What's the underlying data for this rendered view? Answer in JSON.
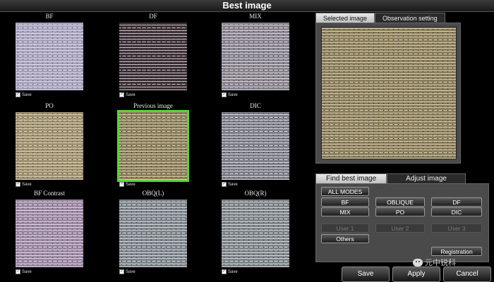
{
  "window": {
    "title": "Best image"
  },
  "tiles": [
    {
      "label": "BF",
      "save": "Save",
      "bg": "#a9a2bd",
      "line": "#e0dcef",
      "dot": "#555"
    },
    {
      "label": "DF",
      "save": "Save",
      "bg": "#3b3036",
      "line": "#c9c3c6",
      "dot": "#111"
    },
    {
      "label": "MIX",
      "save": "Save",
      "bg": "#8a8590",
      "line": "#d8d6dc",
      "dot": "#333"
    },
    {
      "label": "PO",
      "save": "Save",
      "bg": "#9f9170",
      "line": "#ddd4b8",
      "dot": "#444"
    },
    {
      "label": "Previous image",
      "save": "Save",
      "bg": "#8c7f5f",
      "line": "#d9cfa9",
      "dot": "#333"
    },
    {
      "label": "DIC",
      "save": "Save",
      "bg": "#7d7e86",
      "line": "#d9dae0",
      "dot": "#333"
    },
    {
      "label": "BF Contrast",
      "save": "Save",
      "bg": "#9b88a3",
      "line": "#e0d4e6",
      "dot": "#444"
    },
    {
      "label": "OBQ(L)",
      "save": "Save",
      "bg": "#7f868c",
      "line": "#d2d7da",
      "dot": "#333"
    },
    {
      "label": "OBQ(R)",
      "save": "Save",
      "bg": "#7f858a",
      "line": "#d4d8db",
      "dot": "#333"
    }
  ],
  "top_tabs": {
    "selected": "Selected image",
    "observation": "Observation setting"
  },
  "bottom_tabs": {
    "find": "Find best image",
    "adjust": "Adjust image"
  },
  "modes": {
    "all": "ALL MODES",
    "bf": "BF",
    "oblique": "OBLIQUE",
    "df": "DF",
    "mix": "MIX",
    "po": "PO",
    "dic": "DIC",
    "user1": "User 1",
    "user2": "User 2",
    "user3": "User 3",
    "others": "Others",
    "registration": "Registration"
  },
  "actions": {
    "save": "Save",
    "apply": "Apply",
    "cancel": "Cancel"
  },
  "watermark": "元中锐科",
  "colors": {
    "selected_outline": "#5bd33a"
  }
}
